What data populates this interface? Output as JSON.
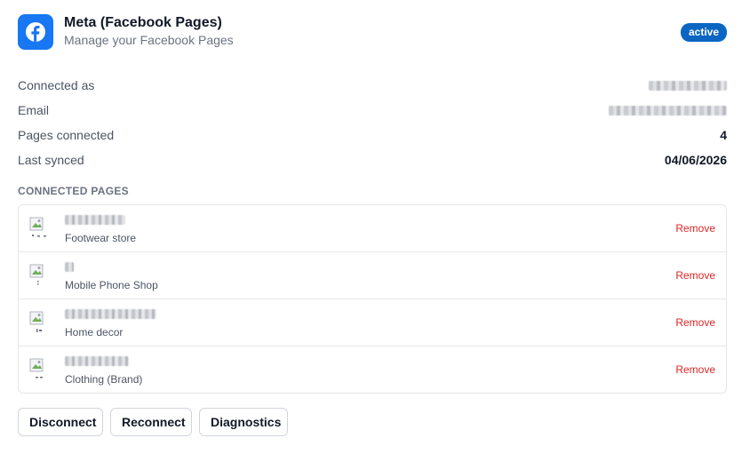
{
  "header": {
    "logo_icon": "facebook-logo-icon",
    "title": "Meta (Facebook Pages)",
    "subtitle": "Manage your Facebook Pages",
    "status_badge": "active",
    "brand_color": "#1877F2",
    "badge_color": "#0a66c2"
  },
  "info": {
    "connected_as_label": "Connected as",
    "email_label": "Email",
    "pages_connected_label": "Pages connected",
    "pages_connected_value": "4",
    "last_synced_label": "Last synced",
    "last_synced_value": "04/06/2026"
  },
  "pages_section": {
    "title": "CONNECTED PAGES",
    "remove_label": "Remove",
    "remove_color": "#dc2626",
    "pages": [
      {
        "category": "Footwear store"
      },
      {
        "category": "Mobile Phone Shop"
      },
      {
        "category": "Home decor"
      },
      {
        "category": "Clothing (Brand)"
      }
    ]
  },
  "actions": {
    "disconnect_label": "Disconnect",
    "reconnect_label": "Reconnect",
    "diagnostics_label": "Diagnostics"
  }
}
